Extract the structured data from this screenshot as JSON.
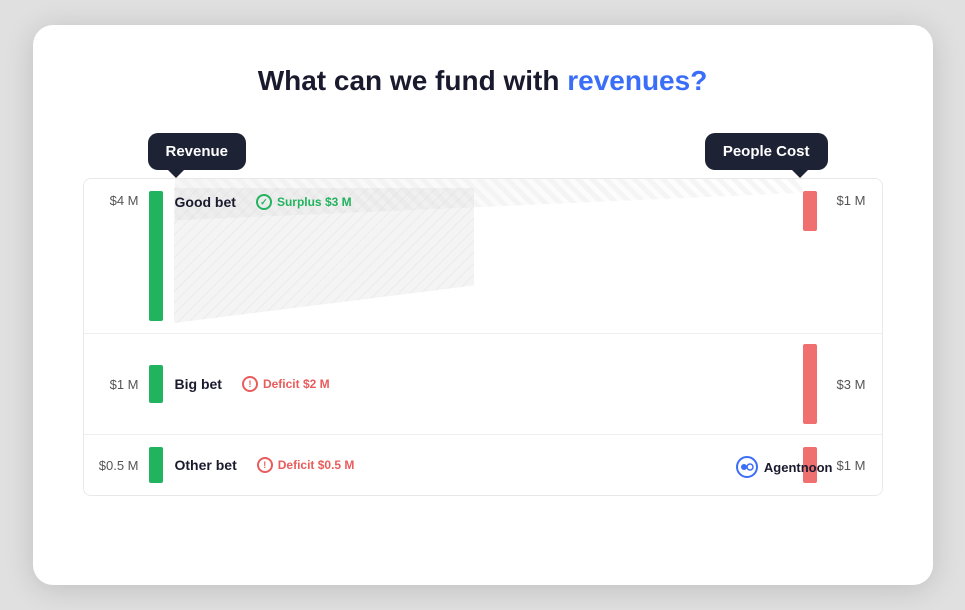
{
  "title": {
    "prefix": "What can we fund with ",
    "highlight": "revenues?",
    "highlight_color": "#3b6ef8"
  },
  "left_label": "Revenue",
  "right_label": "People Cost",
  "rows": [
    {
      "id": "good-bet",
      "name": "Good bet",
      "badge_text": "Surplus $3 M",
      "badge_type": "surplus",
      "left_value": "$4 M",
      "right_value": "$1 M",
      "green_height": 130,
      "red_height": 40
    },
    {
      "id": "big-bet",
      "name": "Big bet",
      "badge_text": "Deficit $2 M",
      "badge_type": "deficit",
      "left_value": "$1 M",
      "right_value": "$3 M",
      "green_height": 36,
      "red_height": 80
    },
    {
      "id": "other-bet",
      "name": "Other bet",
      "badge_text": "Deficit $0.5 M",
      "badge_type": "deficit",
      "left_value": "$0.5 M",
      "right_value": "$1 M",
      "green_height": 36,
      "red_height": 36
    }
  ],
  "brand": {
    "name": "Agentnoon"
  }
}
